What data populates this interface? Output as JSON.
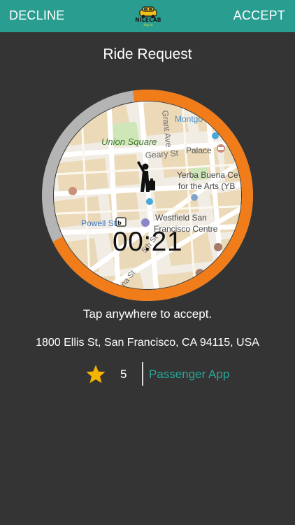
{
  "topbar": {
    "decline_label": "DECLINE",
    "accept_label": "ACCEPT",
    "logo_text": "NILECAB",
    "logo_tagline": "Hop In",
    "bar_color": "#2a9d91"
  },
  "title": "Ride Request",
  "map": {
    "labels": {
      "union_square": "Union Square",
      "geary": "Geary St",
      "grant": "Grant Ave",
      "montgomery": "Montgo",
      "palace": "Palace",
      "yerba1": "Yerba Buena Ce",
      "yerba2": "for the Arts (YB",
      "westfield1": "Westfield San",
      "westfield2": "Francisco Centre",
      "powell": "Powell St",
      "fifth": "5th St",
      "mission": "na St",
      "tre": "tre"
    },
    "icons": [
      "passenger-icon",
      "bart-icon",
      "shopping-bag-icon",
      "hotel-icon",
      "metro-icon"
    ]
  },
  "timer": "00:21",
  "countdown": {
    "remaining_fraction": 0.7,
    "progress_color": "#f07c1a",
    "track_color": "#b4b4b4"
  },
  "hint": "Tap anywhere to accept.",
  "address": "1800 Ellis St, San Francisco, CA 94115, USA",
  "rating": {
    "value": "5",
    "star_color": "#f5b400"
  },
  "app_name": "Passenger App",
  "accent_color": "#2aa596"
}
